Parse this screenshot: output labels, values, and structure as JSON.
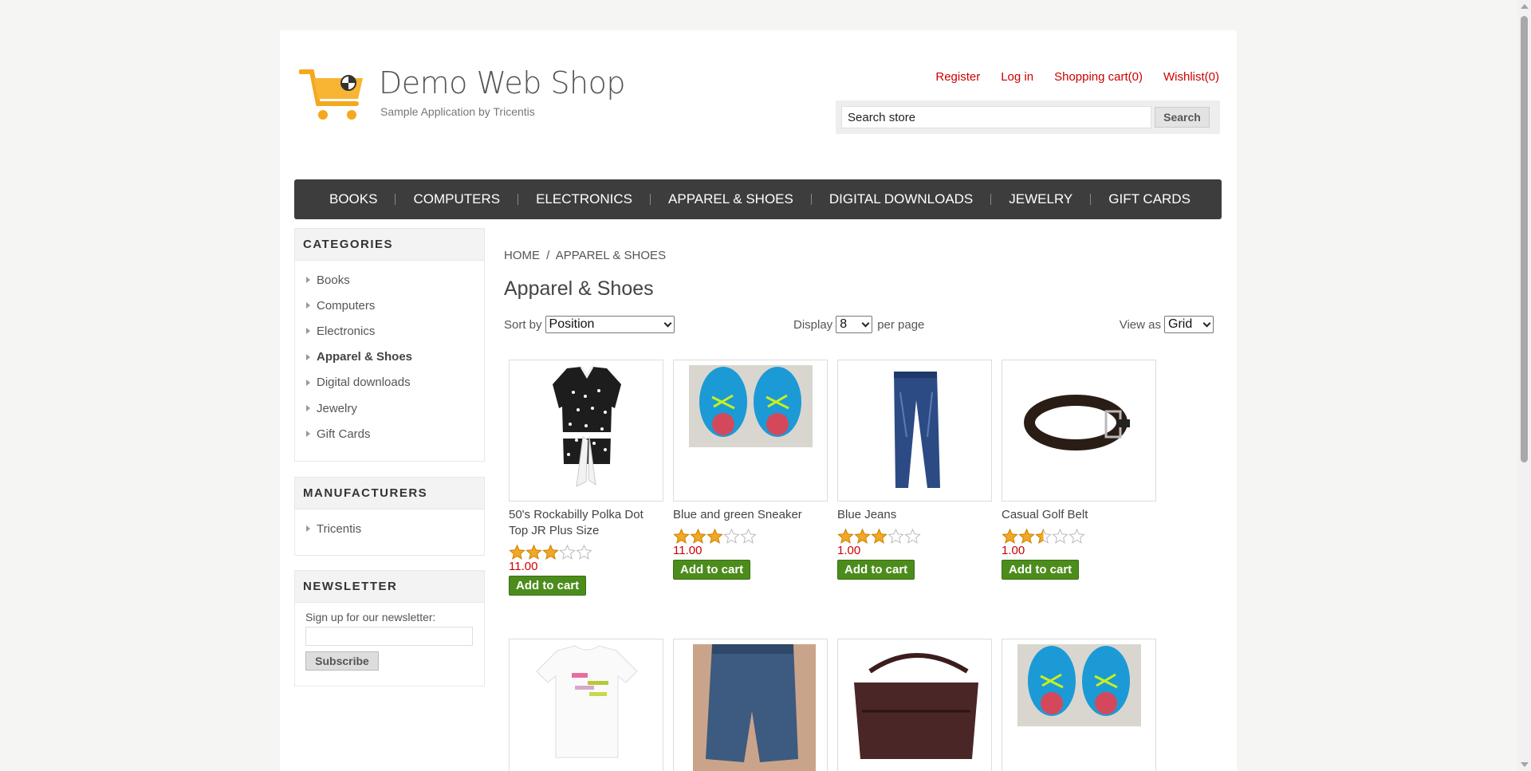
{
  "header": {
    "title": "Demo Web Shop",
    "subtitle": "Sample Application by Tricentis",
    "links": {
      "register": "Register",
      "login": "Log in",
      "cart": "Shopping cart(0)",
      "wishlist": "Wishlist(0)"
    },
    "search": {
      "value": "Search store",
      "button": "Search"
    }
  },
  "topmenu": [
    "BOOKS",
    "COMPUTERS",
    "ELECTRONICS",
    "APPAREL & SHOES",
    "DIGITAL DOWNLOADS",
    "JEWELRY",
    "GIFT CARDS"
  ],
  "sidebar": {
    "categories": {
      "title": "CATEGORIES",
      "items": [
        "Books",
        "Computers",
        "Electronics",
        "Apparel & Shoes",
        "Digital downloads",
        "Jewelry",
        "Gift Cards"
      ],
      "active_index": 3
    },
    "manufacturers": {
      "title": "MANUFACTURERS",
      "items": [
        "Tricentis"
      ]
    },
    "newsletter": {
      "title": "NEWSLETTER",
      "label": "Sign up for our newsletter:",
      "button": "Subscribe"
    }
  },
  "main": {
    "breadcrumb_home": "HOME",
    "breadcrumb_sep": "/",
    "breadcrumb_current": "APPAREL & SHOES",
    "title": "Apparel & Shoes",
    "sort_label": "Sort by",
    "sort_value": "Position",
    "display_label": "Display",
    "display_value": "8",
    "per_page": "per page",
    "view_label": "View as",
    "view_value": "Grid",
    "add_to_cart": "Add to cart"
  },
  "products": [
    {
      "name": "50's Rockabilly Polka Dot Top JR Plus Size",
      "rating": 3,
      "price": "11.00",
      "image": "polka-dot-top"
    },
    {
      "name": "Blue and green Sneaker",
      "rating": 3,
      "price": "11.00",
      "image": "blue-sneaker"
    },
    {
      "name": "Blue Jeans",
      "rating": 3,
      "price": "1.00",
      "image": "blue-jeans"
    },
    {
      "name": "Casual Golf Belt",
      "rating": 2.5,
      "price": "1.00",
      "image": "golf-belt"
    },
    {
      "name": "",
      "rating": 0,
      "price": "",
      "image": "white-tshirt"
    },
    {
      "name": "",
      "rating": 0,
      "price": "",
      "image": "denim-shorts"
    },
    {
      "name": "",
      "rating": 0,
      "price": "",
      "image": "leather-handbag"
    },
    {
      "name": "",
      "rating": 0,
      "price": "",
      "image": "blue-sneaker"
    }
  ],
  "colors": {
    "link": "#cc0000",
    "menu_bg": "#3d3d3d",
    "button_green": "#4c8c1c",
    "star": "#f5a623"
  }
}
